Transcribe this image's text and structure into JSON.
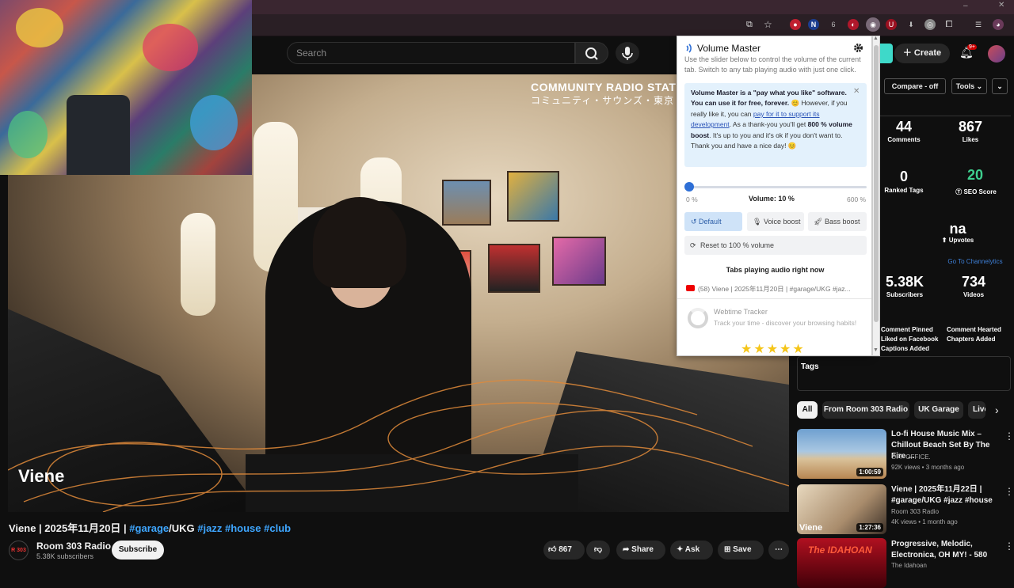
{
  "youtube": {
    "search": {
      "placeholder": "Search"
    },
    "create_label": "Create",
    "notif_badge": "9+"
  },
  "video": {
    "watermark_line1": "COMMUNITY RADIO STAT",
    "watermark_line2": "コミュニティ・サウンズ・東京",
    "overlay_name": "Viene",
    "title_prefix": "Viene | 2025年11月20日 | ",
    "title_tag1": "#garage",
    "title_mid": "/UKG ",
    "title_tag2": "#jazz",
    "title_tag3": "#house",
    "title_tag4": "#club"
  },
  "channel": {
    "avatar_text": "R 303",
    "name": "Room 303 Radio",
    "subscribers": "5.38K subscribers",
    "subscribe_label": "Subscribe"
  },
  "actions": {
    "likes": "867",
    "share": "Share",
    "ask": "Ask",
    "save": "Save"
  },
  "extension_panel": {
    "compare_label": "Compare - off",
    "tools_label": "Tools",
    "comments_value": "44",
    "comments_label": "Comments",
    "likes_value": "867",
    "likes_label": "Likes",
    "ranked_tags_value": "0",
    "ranked_tags_label": "Ranked Tags",
    "seo_value": "20",
    "seo_label": "SEO Score",
    "upvotes_value": "na",
    "upvotes_label": "Upvotes",
    "channelytics_link": "Go To Channelytics",
    "subscribers_value": "5.38K",
    "subscribers_label": "Subscribers",
    "videos_value": "734",
    "videos_label": "Videos",
    "flags": [
      "Comment Pinned",
      "Comment Hearted",
      "Liked on Facebook",
      "Chapters Added",
      "Captions Added"
    ],
    "tags_title": "Tags"
  },
  "chips": [
    "All",
    "From Room 303 Radio",
    "UK Garage",
    "Live"
  ],
  "recommendations": [
    {
      "title": "Lo-fi House Music Mix – Chillout Beach Set By The Fire ...",
      "channel": "OFF OFFICE.",
      "meta": "92K views • 3 months ago",
      "duration": "1:00:59"
    },
    {
      "title": "Viene | 2025年11月22日 | #garage/UKG #jazz #house",
      "channel": "Room 303 Radio",
      "meta": "4K views • 1 month ago",
      "duration": "1:27:36",
      "thumb_text": "Viene"
    },
    {
      "title": "Progressive, Melodic, Electronica, OH MY! - 580",
      "channel": "The Idahoan",
      "meta": "",
      "duration": "",
      "thumb_text": "The IDAHOAN"
    }
  ],
  "volume_master": {
    "title": "Volume Master",
    "description": "Use the slider below to control the volume of the current tab. Switch to any tab playing audio with just one click.",
    "info_bold1": "Volume Master is a \"pay what you like\" software. You can use it for free, forever.",
    "info_text1": " However, if you really like it, you can ",
    "info_link": "pay for it to support its development",
    "info_text2": ". As a thank-you you'll get ",
    "info_bold2": "800 % volume boost",
    "info_text3": ". It's up to you and it's ok if you don't want to. Thank you and have a nice day!",
    "volume_percent": 10,
    "volume_label": "Volume: 10 %",
    "min_label": "0 %",
    "max_label": "600 %",
    "slider_max": 600,
    "btn_default": "Default",
    "btn_voice": "Voice boost",
    "btn_bass": "Bass boost",
    "btn_reset": "Reset to 100 % volume",
    "tabs_heading": "Tabs playing audio right now",
    "tab_entry": "(58) Viene | 2025年11月20日 | #garage/UKG #jaz...",
    "tracker_title": "Webtime Tracker",
    "tracker_desc": "Track your time - discover your browsing habits!",
    "stars": "★★★★★"
  },
  "colors": {
    "accent_blue": "#2e6fd6",
    "info_bg": "#e3f1fc",
    "seo_green": "#3ecf8e",
    "tag_blue": "#3ea6ff"
  }
}
